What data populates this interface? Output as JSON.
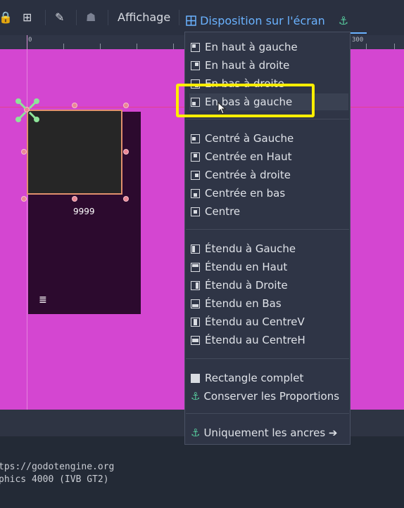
{
  "toolbar": {
    "view_menu": "Affichage",
    "layout_menu": "Disposition sur l'écran"
  },
  "ruler": {
    "labels": [
      "0",
      "300"
    ]
  },
  "canvas": {
    "label_text": "9999"
  },
  "menu": {
    "group1": [
      "En haut à gauche",
      "En haut à droite",
      "En bas à droite",
      "En bas à gauche"
    ],
    "group2": [
      "Centré à Gauche",
      "Centrée en Haut",
      "Centrée à droite",
      "Centrée en bas",
      "Centre"
    ],
    "group3": [
      "Étendu à Gauche",
      "Étendu en Haut",
      "Étendu à Droite",
      "Étendu en Bas",
      "Étendu au CentreV",
      "Étendu au CentreH"
    ],
    "group4": [
      "Rectangle complet",
      "Conserver les Proportions"
    ],
    "anchors_only": "Uniquement les ancres ➔",
    "highlighted": "En bas à gauche"
  },
  "console": {
    "line1": "tps://godotengine.org",
    "line2": "phics 4000 (IVB GT2)"
  },
  "colors": {
    "highlight_box": "#ffee00",
    "canvas_bg": "#d446d1",
    "accent": "#6ab2ff",
    "anchor": "#56c79b"
  }
}
